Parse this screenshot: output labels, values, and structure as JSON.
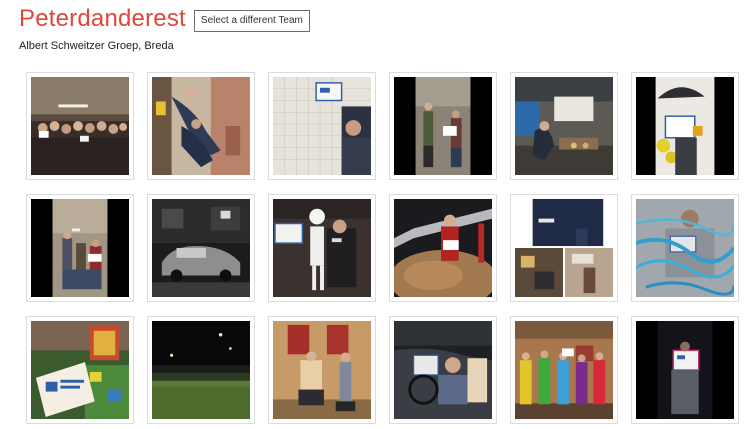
{
  "team": {
    "name": "Peterdanderest",
    "change_button_label": "Select a different Team",
    "organization": "Albert Schweitzer Groep, Breda"
  },
  "colors": {
    "title": "#e0463a",
    "border": "#dcdcdc"
  },
  "gallery": {
    "photos": [
      {
        "icon": "group-photo"
      },
      {
        "icon": "people-climbing-photo"
      },
      {
        "icon": "person-holding-sign-photo"
      },
      {
        "icon": "person-holding-sign-photo"
      },
      {
        "icon": "people-on-floor-photo"
      },
      {
        "icon": "person-with-umbrella-photo"
      },
      {
        "icon": "people-posing-photo"
      },
      {
        "icon": "car-night-photo"
      },
      {
        "icon": "skeleton-costume-photo"
      },
      {
        "icon": "person-in-sand-photo"
      },
      {
        "icon": "collage-photo"
      },
      {
        "icon": "person-behind-plastic-photo"
      },
      {
        "icon": "game-board-photo"
      },
      {
        "icon": "dark-field-photo"
      },
      {
        "icon": "people-with-chairs-photo"
      },
      {
        "icon": "people-in-car-photo"
      },
      {
        "icon": "people-in-costumes-photo"
      },
      {
        "icon": "dark-sign-photo"
      }
    ]
  }
}
